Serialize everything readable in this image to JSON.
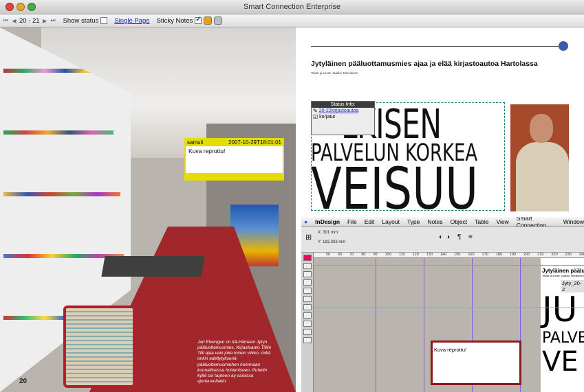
{
  "window": {
    "title": "Smart Connection Enterprise"
  },
  "toolbar": {
    "page_range": "20 - 21",
    "show_status": "Show status",
    "single_page": "Single Page",
    "sticky_notes": "Sticky Notes"
  },
  "left_page": {
    "page_number": "20",
    "caption": "Jarl Elvengen on Itä-Hämeen Jytyn pääluottamusmies. Kirjastoauto Tilliin Tilli ajaa vain joka toinen viikko, mikä onkin edellytyksenä pääluottamusmiehen hommaan kunnallisessa hoitamiseen. Puhelin kyllä soi tarpeen ay-asioissa ajoneuvollakin.",
    "sticky_note": {
      "user": "samuli",
      "timestamp": "2007-10-29T18:01:01",
      "text": "Kuva reprottu!"
    }
  },
  "right_page": {
    "headline": "Jytyläinen pääluottamusmies ajaa ja elää kirjastoautoa Hartolassa",
    "byline": "Teksti ja kuvat: Jaakko Tekniikinen",
    "big_line1": "LKISEN",
    "big_line2": "PALVELUN KORKEA",
    "big_line3": "VEISUU",
    "status_box": {
      "title": "Status Info:",
      "link": "20-22kirjastoautoa",
      "state": "korjatut"
    }
  },
  "indesign": {
    "menus": [
      "InDesign",
      "File",
      "Edit",
      "Layout",
      "Type",
      "Notes",
      "Object",
      "Table",
      "View",
      "Smart Connection",
      "Window"
    ],
    "x_field": "X: 301 mm",
    "y_field": "Y: 183,333 mm",
    "doc_tab": "Jyty_20-2",
    "ruler_ticks": [
      "50",
      "60",
      "70",
      "80",
      "90",
      "100",
      "110",
      "120",
      "130",
      "140",
      "150",
      "160",
      "170",
      "180",
      "190",
      "200",
      "210",
      "220",
      "230",
      "240",
      "250"
    ],
    "note_text": "Kuva reprottu!",
    "doc_headline": "Jytyläinen päälu",
    "doc_byline": "Teksti ja kuvat: Jaakko Tekniikinen",
    "doc_big1": "JU",
    "doc_big2": "PALVE",
    "doc_big3": "VE"
  },
  "colors": {
    "accent": "#3c5aa6",
    "sticky": "#e6dd00",
    "carpet": "#a1272c"
  }
}
